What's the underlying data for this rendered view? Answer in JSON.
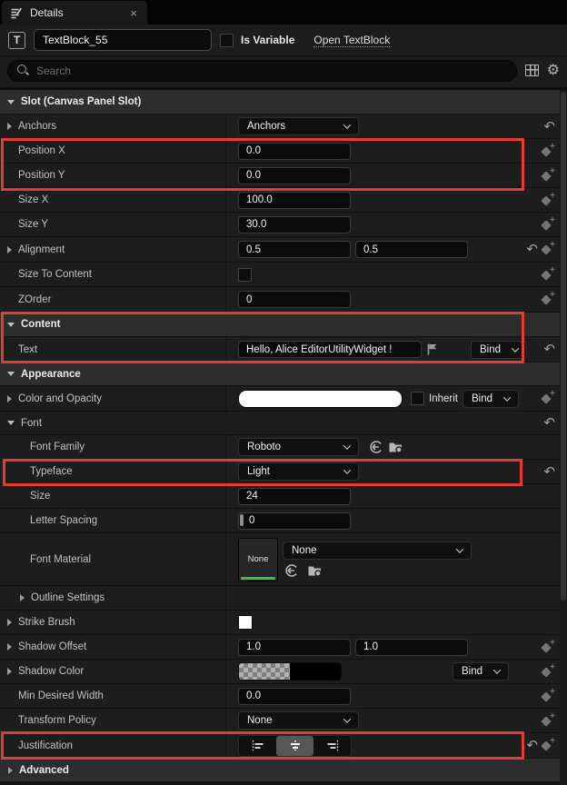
{
  "annotation_color": "#e63a35",
  "icons": {
    "close": "×",
    "reset": "↶",
    "gear": "⚙",
    "type_letter": "T",
    "diamond_plus": "+"
  },
  "tab": {
    "title": "Details"
  },
  "header": {
    "object_name": "TextBlock_55",
    "is_variable_label": "Is Variable",
    "open_link": "Open TextBlock"
  },
  "search": {
    "placeholder": "Search"
  },
  "rows": {
    "slot_header": {
      "label": "Slot (Canvas Panel Slot)"
    },
    "anchors": {
      "label": "Anchors",
      "value": "Anchors"
    },
    "position_x": {
      "label": "Position X",
      "value": "0.0"
    },
    "position_y": {
      "label": "Position Y",
      "value": "0.0"
    },
    "size_x": {
      "label": "Size X",
      "value": "100.0"
    },
    "size_y": {
      "label": "Size Y",
      "value": "30.0"
    },
    "alignment": {
      "label": "Alignment",
      "value_x": "0.5",
      "value_y": "0.5"
    },
    "size_to_content": {
      "label": "Size To Content"
    },
    "zorder": {
      "label": "ZOrder",
      "value": "0"
    },
    "content_header": {
      "label": "Content"
    },
    "text": {
      "label": "Text",
      "value": "Hello, Alice EditorUtilityWidget !",
      "bind_label": "Bind"
    },
    "appearance_header": {
      "label": "Appearance"
    },
    "color_and_opacity": {
      "label": "Color and Opacity",
      "swatch_color": "#ffffff",
      "inherit_label": "Inherit",
      "bind_label": "Bind"
    },
    "font_group": {
      "label": "Font"
    },
    "font_family": {
      "label": "Font Family",
      "value": "Roboto"
    },
    "typeface": {
      "label": "Typeface",
      "value": "Light"
    },
    "font_size": {
      "label": "Size",
      "value": "24"
    },
    "letter_spacing": {
      "label": "Letter Spacing",
      "value": "0"
    },
    "font_material": {
      "label": "Font Material",
      "thumb_label": "None",
      "value": "None"
    },
    "outline_settings": {
      "label": "Outline Settings"
    },
    "strike_brush": {
      "label": "Strike Brush",
      "swatch_color": "#ffffff"
    },
    "shadow_offset": {
      "label": "Shadow Offset",
      "value_x": "1.0",
      "value_y": "1.0"
    },
    "shadow_color": {
      "label": "Shadow Color",
      "bind_label": "Bind"
    },
    "min_desired_width": {
      "label": "Min Desired Width",
      "value": "0.0"
    },
    "transform_policy": {
      "label": "Transform Policy",
      "value": "None"
    },
    "justification": {
      "label": "Justification",
      "selected": "center"
    },
    "advanced_header": {
      "label": "Advanced"
    }
  }
}
